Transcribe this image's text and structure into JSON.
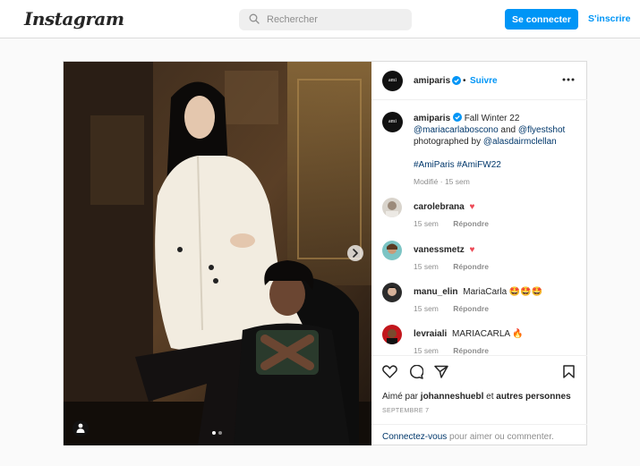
{
  "nav": {
    "logo": "Instagram",
    "search_placeholder": "Rechercher",
    "login_button": "Se connecter",
    "signup_link": "S'inscrire"
  },
  "post": {
    "author": "amiparis",
    "author_avatar_text": "ami",
    "follow_label": "Suivre",
    "carousel": {
      "current": 1,
      "total": 2
    },
    "caption": {
      "author": "amiparis",
      "text_1": "Fall Winter 22",
      "mention_1": "@mariacarlaboscono",
      "text_2": "and",
      "mention_2": "@flyestshot",
      "text_3": "photographed by",
      "mention_3": "@alasdairmclellan",
      "hashtag_1": "#AmiParis",
      "hashtag_2": "#AmiFW22",
      "meta": "Modifié · 15 sem"
    },
    "comments": [
      {
        "user": "carolebrana",
        "text": "♥",
        "time": "15 sem",
        "reply": "Répondre"
      },
      {
        "user": "vanessmetz",
        "text": "♥",
        "time": "15 sem",
        "reply": "Répondre"
      },
      {
        "user": "manu_elin",
        "text": "MariaCarla 🤩🤩🤩",
        "time": "15 sem",
        "reply": "Répondre"
      },
      {
        "user": "levraiali",
        "text": "MARIACARLA 🔥",
        "time": "15 sem",
        "reply": "Répondre"
      }
    ],
    "likes_prefix": "Aimé par",
    "likes_user": "johanneshuebl",
    "likes_and": "et",
    "likes_others": "autres personnes",
    "date": "SEPTEMBRE 7",
    "login_link": "Connectez-vous",
    "login_suffix": "pour aimer ou commenter."
  },
  "colors": {
    "accent": "#0095f6",
    "heart": "#ed4956",
    "link": "#00376b",
    "muted": "#8e8e8e"
  }
}
